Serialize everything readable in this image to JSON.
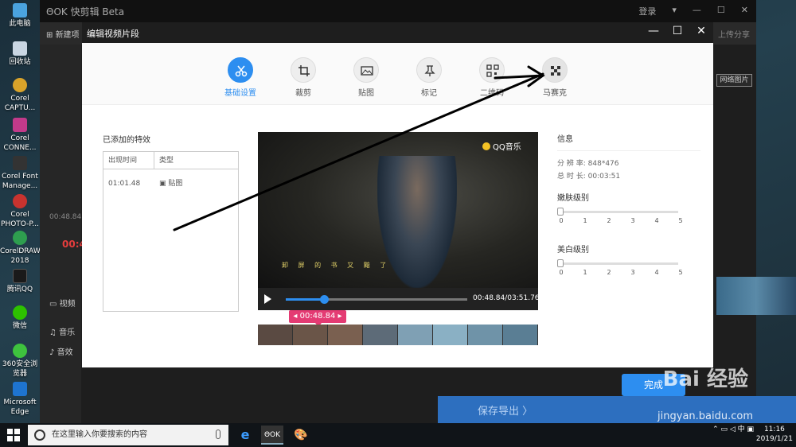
{
  "desktop": {
    "icons": [
      {
        "label": "此电脑",
        "icon": "computer-icon",
        "color": "#4aa3df"
      },
      {
        "label": "回收站",
        "icon": "recycle-bin-icon",
        "color": "#c9d6e3"
      },
      {
        "label": "Corel CAPTU...",
        "icon": "corel-capture-icon",
        "color": "#d9a32a"
      },
      {
        "label": "Corel CONNE...",
        "icon": "corel-connect-icon",
        "color": "#c23a8a"
      },
      {
        "label": "Corel Font Manage...",
        "icon": "corel-font-icon",
        "color": "#222"
      },
      {
        "label": "Corel PHOTO-P...",
        "icon": "corel-photo-icon",
        "color": "#c8332f"
      },
      {
        "label": "CorelDRAW 2018",
        "icon": "coreldraw-icon",
        "color": "#2e9e4f"
      },
      {
        "label": "腾讯QQ",
        "icon": "qq-icon",
        "color": "#1a1a1a"
      },
      {
        "label": "微信",
        "icon": "wechat-icon",
        "color": "#2dc100"
      },
      {
        "label": "360安全浏览器",
        "icon": "browser-360-icon",
        "color": "#3ec33e"
      },
      {
        "label": "Microsoft Edge",
        "icon": "edge-icon",
        "color": "#1e74d0"
      }
    ]
  },
  "app": {
    "logo": "ΘOK 快剪辑 Beta",
    "login": "登录",
    "new_project": "新建项",
    "upload_share": "上传分享",
    "network_image": "网络图片",
    "timecode": "00:4",
    "time_small": "00:48.84",
    "video_track": "视频",
    "music_track": "音乐",
    "sfx_track": "音效",
    "save_export": "保存导出 〉",
    "done": "完成"
  },
  "dialog": {
    "title": "编辑视频片段",
    "tools": [
      {
        "label": "基础设置",
        "icon": "scissors-icon",
        "active": true
      },
      {
        "label": "裁剪",
        "icon": "crop-icon",
        "active": false
      },
      {
        "label": "贴图",
        "icon": "sticker-image-icon",
        "active": false
      },
      {
        "label": "标记",
        "icon": "pin-marker-icon",
        "active": false
      },
      {
        "label": "二维码",
        "icon": "qr-code-icon",
        "active": false
      },
      {
        "label": "马赛克",
        "icon": "mosaic-icon",
        "active": false
      }
    ],
    "effects_title": "已添加的特效",
    "effects_columns": [
      "出现时间",
      "类型"
    ],
    "effects_rows": [
      {
        "time": "01:01.48",
        "type": "贴图"
      }
    ],
    "video": {
      "watermark": "QQ音乐",
      "subtitle": "卸 屏 的 书 又 黯 了",
      "time_display": "00:48.84/03:51.76",
      "progress": 0.21,
      "clip_tag": "00:48.84"
    },
    "info": {
      "title": "信息",
      "resolution_label": "分 辨 率:",
      "resolution": "848*476",
      "duration_label": "总 时 长:",
      "duration": "00:03:51",
      "skin_label": "嫩肤级别",
      "whiten_label": "美白级别",
      "scale": [
        "0",
        "1",
        "2",
        "3",
        "4",
        "5"
      ],
      "skin_level": 0,
      "whiten_level": 0
    }
  },
  "watermark": {
    "brand": "Bai 经验",
    "url": "jingyan.baidu.com"
  },
  "taskbar": {
    "search_placeholder": "在这里输入你要搜索的内容",
    "time": "11:16",
    "date": "2019/1/21",
    "apps": [
      "edge-icon",
      "kuaijianji-icon",
      "paint-icon"
    ]
  }
}
